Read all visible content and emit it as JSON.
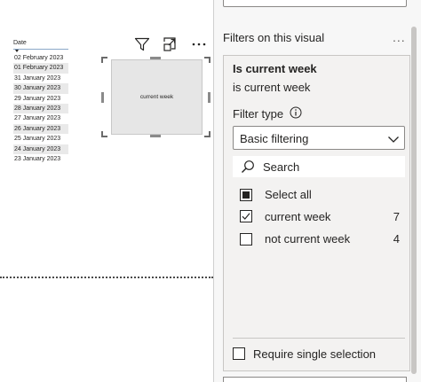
{
  "table": {
    "header": "Date",
    "rows": [
      "02 February 2023",
      "01 February 2023",
      "31 January 2023",
      "30 January 2023",
      "29 January 2023",
      "28 January 2023",
      "27 January 2023",
      "26 January 2023",
      "25 January 2023",
      "24 January 2023",
      "23 January 2023"
    ]
  },
  "visual": {
    "card_text": "current week",
    "header_icons": [
      "filter-icon",
      "focus-mode-icon",
      "more-options-icon"
    ]
  },
  "pane": {
    "title": "Filters on this visual",
    "more": "...",
    "card": {
      "title": "Is current week",
      "subtitle": "is current week",
      "filter_type_label": "Filter type",
      "filter_type_value": "Basic filtering",
      "search_placeholder": "Search",
      "select_all": "Select all",
      "options": [
        {
          "label": "current week",
          "count": "7",
          "checked": true
        },
        {
          "label": "not current week",
          "count": "4",
          "checked": false
        }
      ],
      "require_single": "Require single selection"
    }
  },
  "colors": {
    "pane_bg": "#f7f7f7",
    "card_bg": "#f3f2f1",
    "row_alt": "#e9e9e9",
    "text": "#252423"
  }
}
